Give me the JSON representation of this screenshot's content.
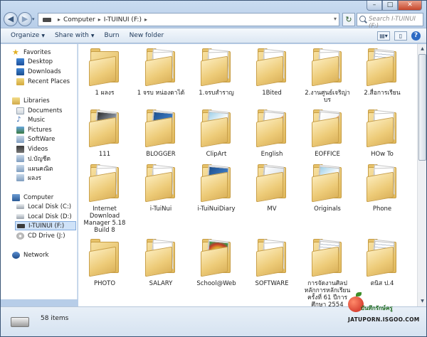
{
  "address": {
    "crumbs": [
      "Computer",
      "I-TUINUI (F:)"
    ],
    "search_placeholder": "Search I-TUINUI (F:)"
  },
  "toolbar": {
    "organize": "Organize",
    "share": "Share with",
    "burn": "Burn",
    "new_folder": "New folder"
  },
  "nav": {
    "favorites": "Favorites",
    "desktop": "Desktop",
    "downloads": "Downloads",
    "recent": "Recent Places",
    "libraries": "Libraries",
    "documents": "Documents",
    "music": "Music",
    "pictures": "Pictures",
    "software": "SoftWare",
    "videos": "Videos",
    "lib_a": "ป.บัญชีด",
    "lib_b": "แผนคณิต",
    "lib_c": "ผลงร",
    "computer": "Computer",
    "local_c": "Local Disk (C:)",
    "local_d": "Local Disk (D:)",
    "drive_f": "I-TUINUI (F:)",
    "cd_j": "CD Drive (J:)",
    "network": "Network"
  },
  "folders": [
    {
      "label": "1 ผลงร",
      "style": "plain"
    },
    {
      "label": "1 จรบ หน่องดาได้",
      "style": "paper"
    },
    {
      "label": "1.จรบสำราญ",
      "style": "paper"
    },
    {
      "label": "1Bited",
      "style": "paper"
    },
    {
      "label": "2.งานศูนย์เจริญ่าบร",
      "style": "paper"
    },
    {
      "label": "2.สื่อการเรียน",
      "style": "doc"
    },
    {
      "label": "111",
      "style": "dark"
    },
    {
      "label": "BLOGGER",
      "style": "blue"
    },
    {
      "label": "ClipArt",
      "style": "photo"
    },
    {
      "label": "English",
      "style": "orange"
    },
    {
      "label": "EOFFICE",
      "style": "orange"
    },
    {
      "label": "HOw To",
      "style": "paper"
    },
    {
      "label": "Internet Download Manager 5.18 Build 8",
      "style": "paper"
    },
    {
      "label": "i-TuiNui",
      "style": "paper"
    },
    {
      "label": "i-TuiNuiDiary",
      "style": "blue"
    },
    {
      "label": "MV",
      "style": "music"
    },
    {
      "label": "Originals",
      "style": "photo"
    },
    {
      "label": "Phone",
      "style": "paper"
    },
    {
      "label": "PHOTO",
      "style": "plain"
    },
    {
      "label": "SALARY",
      "style": "paper"
    },
    {
      "label": "School@Web",
      "style": "chrome"
    },
    {
      "label": "SOFTWARE",
      "style": "paper"
    },
    {
      "label": "การจัดงานศิลปหลักการหลักเรียนครั้งที่ 61 ปีการศึกษา 2554",
      "style": "doc"
    },
    {
      "label": "ตนิส ป.4",
      "style": "doc"
    }
  ],
  "status": {
    "count": "58 items"
  },
  "watermark": {
    "thai": "บันทึกรักษ์ครู",
    "site": "JATUPORN.ISGOO.COM"
  }
}
